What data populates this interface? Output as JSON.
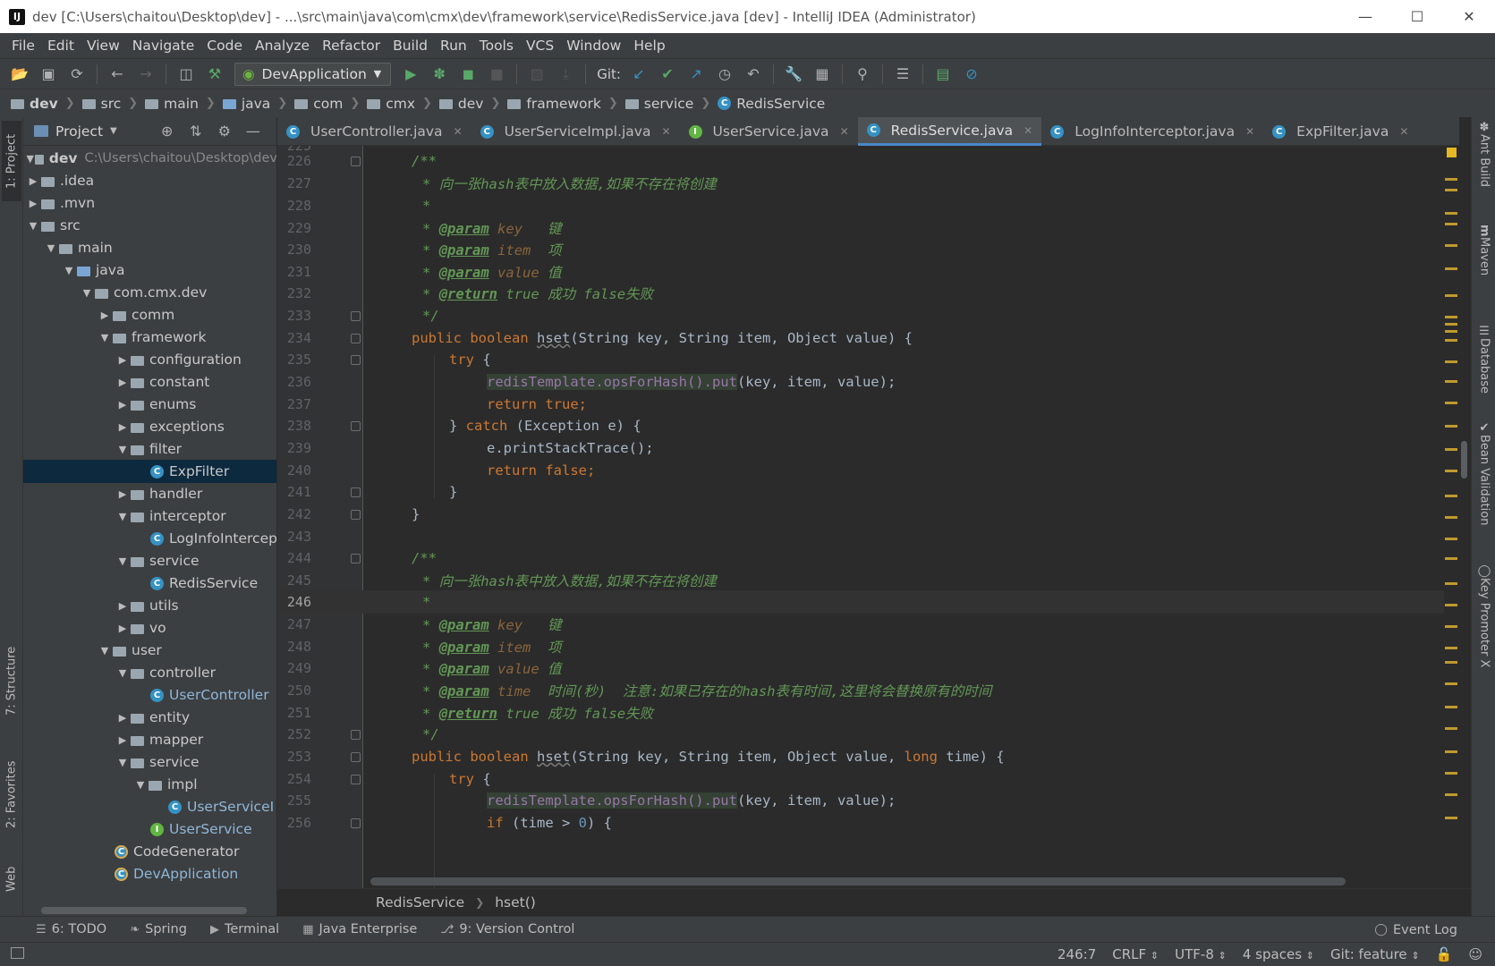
{
  "window": {
    "title": "dev [C:\\Users\\chaitou\\Desktop\\dev] - ...\\src\\main\\java\\com\\cmx\\dev\\framework\\service\\RedisService.java [dev] - IntelliJ IDEA (Administrator)",
    "app_icon": "IJ"
  },
  "menu": [
    "File",
    "Edit",
    "View",
    "Navigate",
    "Code",
    "Analyze",
    "Refactor",
    "Build",
    "Run",
    "Tools",
    "VCS",
    "Window",
    "Help"
  ],
  "toolbar": {
    "run_config": "DevApplication",
    "git_label": "Git:"
  },
  "breadcrumb": [
    "dev",
    "src",
    "main",
    "java",
    "com",
    "cmx",
    "dev",
    "framework",
    "service",
    "RedisService"
  ],
  "left_strip": {
    "project": "1: Project",
    "structure": "7: Structure",
    "favorites": "2: Favorites",
    "web": "Web"
  },
  "project": {
    "title": "Project",
    "root_name": "dev",
    "root_path": "C:\\Users\\chaitou\\Desktop\\dev",
    "nodes": [
      {
        "label": ".idea"
      },
      {
        "label": ".mvn"
      },
      {
        "label": "src"
      },
      {
        "label": "main"
      },
      {
        "label": "java"
      },
      {
        "label": "com.cmx.dev"
      },
      {
        "label": "comm"
      },
      {
        "label": "framework"
      },
      {
        "label": "configuration"
      },
      {
        "label": "constant"
      },
      {
        "label": "enums"
      },
      {
        "label": "exceptions"
      },
      {
        "label": "filter"
      },
      {
        "label": "ExpFilter"
      },
      {
        "label": "handler"
      },
      {
        "label": "interceptor"
      },
      {
        "label": "LogInfoIntercep"
      },
      {
        "label": "service"
      },
      {
        "label": "RedisService"
      },
      {
        "label": "utils"
      },
      {
        "label": "vo"
      },
      {
        "label": "user"
      },
      {
        "label": "controller"
      },
      {
        "label": "UserController"
      },
      {
        "label": "entity"
      },
      {
        "label": "mapper"
      },
      {
        "label": "service"
      },
      {
        "label": "impl"
      },
      {
        "label": "UserServiceI"
      },
      {
        "label": "UserService"
      },
      {
        "label": "CodeGenerator"
      },
      {
        "label": "DevApplication"
      }
    ]
  },
  "tabs": [
    {
      "label": "UserController.java"
    },
    {
      "label": "UserServiceImpl.java"
    },
    {
      "label": "UserService.java"
    },
    {
      "label": "RedisService.java"
    },
    {
      "label": "LogInfoInterceptor.java"
    },
    {
      "label": "ExpFilter.java"
    }
  ],
  "editor": {
    "current_line": 246,
    "lines": [
      {
        "n": "225"
      },
      {
        "n": "226"
      },
      {
        "n": "227"
      },
      {
        "n": "228"
      },
      {
        "n": "229"
      },
      {
        "n": "230"
      },
      {
        "n": "231"
      },
      {
        "n": "232"
      },
      {
        "n": "233"
      },
      {
        "n": "234"
      },
      {
        "n": "235"
      },
      {
        "n": "236"
      },
      {
        "n": "237"
      },
      {
        "n": "238"
      },
      {
        "n": "239"
      },
      {
        "n": "240"
      },
      {
        "n": "241"
      },
      {
        "n": "242"
      },
      {
        "n": "243"
      },
      {
        "n": "244"
      },
      {
        "n": "245"
      },
      {
        "n": "246"
      },
      {
        "n": "247"
      },
      {
        "n": "248"
      },
      {
        "n": "249"
      },
      {
        "n": "250"
      },
      {
        "n": "251"
      },
      {
        "n": "252"
      },
      {
        "n": "253"
      },
      {
        "n": "254"
      },
      {
        "n": "255"
      },
      {
        "n": "256"
      }
    ],
    "text": {
      "c_open": "/**",
      "c_star": "*",
      "c_end": "*/",
      "desc": "向一张hash表中放入数据,如果不存在将创建",
      "tag_param": "@param",
      "tag_return": "@return",
      "p_key": "key",
      "p_key_d": "键",
      "p_item": "item",
      "p_item_d": "项",
      "p_value": "value",
      "p_value_d": "值",
      "p_time": "time",
      "p_time_d": "时间(秒)  注意:如果已存在的hash表有时间,这里将会替换原有的时间",
      "ret_true": "true",
      "ret_true_d": "成功",
      "ret_false": "false失败",
      "public": "public",
      "boolean": "boolean",
      "hset": "hset",
      "sig1": "(String key, String item, Object value) {",
      "sig2a": "(String key, String item, Object value, ",
      "long": "long",
      "sig2b": " time) {",
      "try": "try",
      "brace_open": " {",
      "redis_call": "redisTemplate.opsForHash().put",
      "put_args": "(key, item, value);",
      "return": "return",
      "true_semi": " true;",
      "false_semi": " false;",
      "catch_close": "} ",
      "catch": "catch",
      "catch_rest": " (Exception e) {",
      "print": "e.printStackTrace();",
      "close": "}",
      "if": "if",
      "if_rest": " (time > ",
      "zero": "0",
      "if_end": ") {"
    }
  },
  "right_strip": [
    "Ant Build",
    "Maven",
    "Database",
    "Bean Validation",
    "Key Promoter X"
  ],
  "editor_crumb": {
    "class": "RedisService",
    "method": "hset()"
  },
  "bottom_tabs": [
    "6: TODO",
    "Spring",
    "Terminal",
    "Java Enterprise",
    "9: Version Control"
  ],
  "event_log": "Event Log",
  "status": {
    "position": "246:7",
    "line_sep": "CRLF",
    "encoding": "UTF-8",
    "indent": "4 spaces",
    "git": "Git: feature"
  }
}
